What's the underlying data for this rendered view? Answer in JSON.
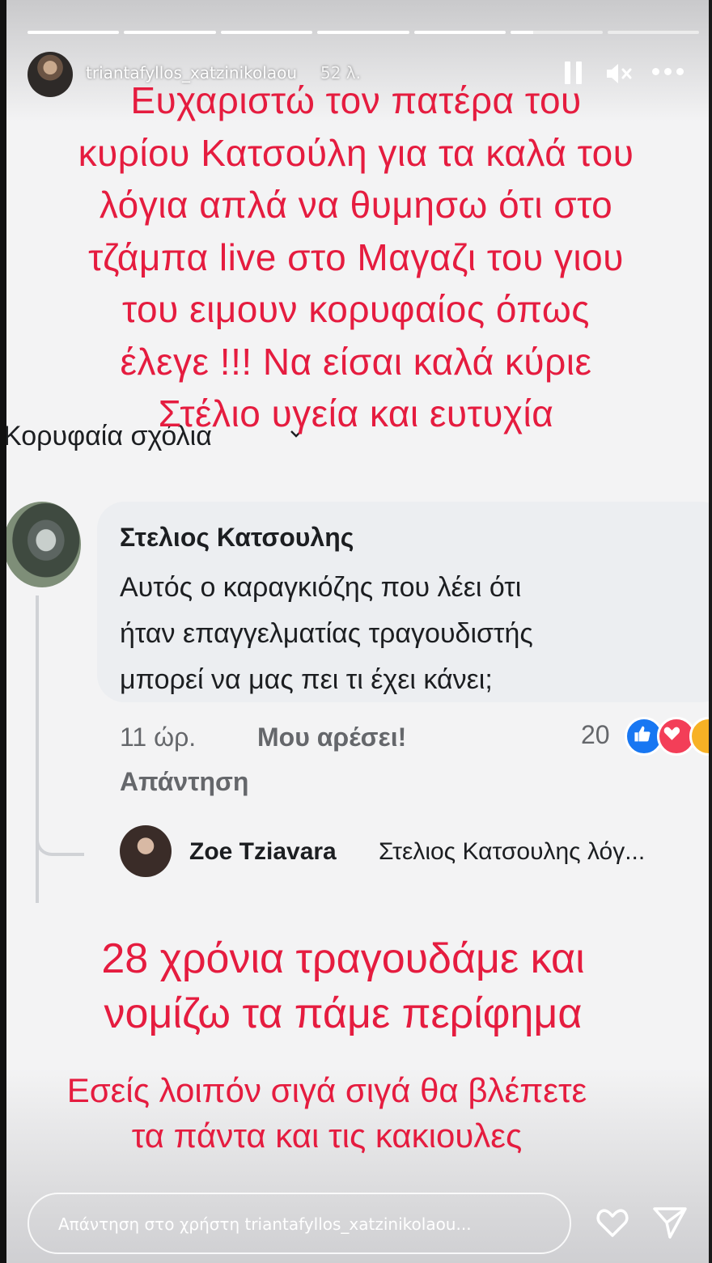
{
  "story": {
    "username": "triantafyllos_xatzinikolaou",
    "time_ago": "52 λ.",
    "segments": [
      1,
      1,
      1,
      1,
      1,
      0.25,
      0
    ],
    "icons": [
      "pause-icon",
      "mute-icon",
      "more-icon",
      "heart-icon",
      "send-icon"
    ]
  },
  "overlay": {
    "top_lines": [
      "Ευχαριστώ τον πατέρα του",
      "κυρίου Κατσούλη για τα καλά του",
      "λόγια απλά να θυμησω ότι στο",
      "τζάμπα live στο Μαγαζι του γιου",
      "του ειμουν κορυφαίος όπως",
      "έλεγε !!! Να είσαι καλά κύριε",
      "Στέλιο υγεία και ευτυχία"
    ],
    "mid_lines": [
      "28 χρόνια τραγουδάμε και",
      "νομίζω τα πάμε περίφημα"
    ],
    "bottom_lines": [
      "Εσείς λοιπόν σιγά σιγά θα βλέπετε",
      "τα πάντα και τις κακιουλες"
    ],
    "color": "#e51c3f"
  },
  "fb": {
    "heading": "Κορυφαία σχόλια",
    "comment": {
      "author": "Στελιος Κατσουλης",
      "lines": [
        "Αυτός ο καραγκιόζης που λέει ότι",
        "ήταν επαγγελματίας τραγουδιστής",
        "μπορεί να μας πει τι έχει κάνει;"
      ],
      "time": "11 ώρ.",
      "like": "Μου αρέσει!",
      "reply": "Απάντηση",
      "reaction_count": "20"
    },
    "reply": {
      "author": "Zoe Tziavara",
      "snippet": "Στελιος Κατσουλης λόγ..."
    }
  },
  "reply_bar": {
    "placeholder": "Απάντηση στο χρήστη triantafyllos_xatzinikolaou..."
  }
}
